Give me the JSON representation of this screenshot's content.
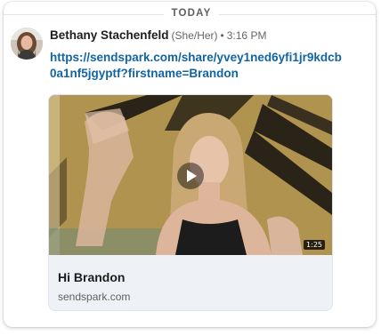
{
  "divider": {
    "label": "TODAY"
  },
  "message": {
    "author": "Bethany Stachenfeld",
    "pronouns": "(She/Her)",
    "separator": "•",
    "time": "3:16 PM",
    "link_text": "https://sendspark.com/share/yvey1ned6yfi1jr9kdcb0a1nf5jgyptf?firstname=Brandon"
  },
  "preview": {
    "duration": "1:25",
    "title": "Hi Brandon",
    "domain": "sendspark.com"
  },
  "colors": {
    "link": "#1264a3",
    "preview_background": "#eef1f6"
  }
}
